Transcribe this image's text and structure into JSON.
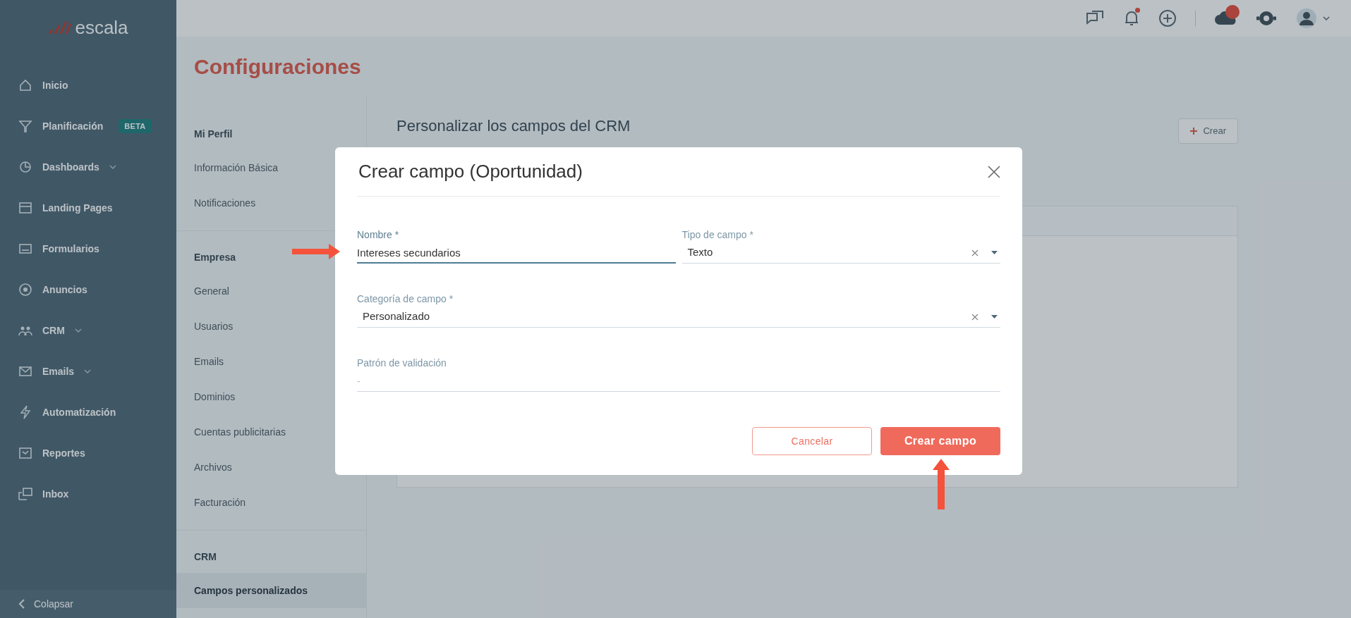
{
  "sidebar": {
    "logo": "escala",
    "items": [
      {
        "label": "Inicio",
        "has_submenu": false
      },
      {
        "label": "Planificación",
        "has_submenu": false,
        "badge": "BETA"
      },
      {
        "label": "Dashboards",
        "has_submenu": true
      },
      {
        "label": "Landing Pages",
        "has_submenu": false
      },
      {
        "label": "Formularios",
        "has_submenu": false
      },
      {
        "label": "Anuncios",
        "has_submenu": false
      },
      {
        "label": "CRM",
        "has_submenu": true
      },
      {
        "label": "Emails",
        "has_submenu": true
      },
      {
        "label": "Automatización",
        "has_submenu": false
      },
      {
        "label": "Reportes",
        "has_submenu": false
      },
      {
        "label": "Inbox",
        "has_submenu": false
      }
    ],
    "collapse": "Colapsar"
  },
  "page_title": "Configuraciones",
  "settings_menu": [
    {
      "heading": "Mi Perfil",
      "items": [
        {
          "label": "Información Básica",
          "selected": false
        },
        {
          "label": "Notificaciones",
          "selected": false
        }
      ]
    },
    {
      "heading": "Empresa",
      "items": [
        {
          "label": "General",
          "selected": false
        },
        {
          "label": "Usuarios",
          "selected": false
        },
        {
          "label": "Emails",
          "selected": false
        },
        {
          "label": "Dominios",
          "selected": false
        },
        {
          "label": "Cuentas publicitarias",
          "selected": false
        },
        {
          "label": "Archivos",
          "selected": false
        },
        {
          "label": "Facturación",
          "selected": false
        }
      ]
    },
    {
      "heading": "CRM",
      "items": [
        {
          "label": "Campos personalizados",
          "selected": true
        }
      ]
    }
  ],
  "content": {
    "heading": "Personalizar los campos del CRM",
    "create_button": "Crear"
  },
  "modal": {
    "title": "Crear campo (Oportunidad)",
    "rows": [
      [
        {
          "kind": "text",
          "label": "Nombre *",
          "value": "Intereses secundarios",
          "focused": true
        },
        {
          "kind": "select",
          "label": "Tipo de campo *",
          "value": "Texto",
          "focused": false
        }
      ],
      [
        {
          "kind": "select",
          "label": "Categoría de campo *",
          "value": "Personalizado",
          "focused": false
        }
      ],
      [
        {
          "kind": "text",
          "label": "Patrón de validación",
          "placeholder": "-",
          "focused": false
        }
      ]
    ],
    "buttons": [
      {
        "kind": "secondary",
        "label": "Cancelar"
      },
      {
        "kind": "primary",
        "label": "Crear campo"
      }
    ]
  }
}
